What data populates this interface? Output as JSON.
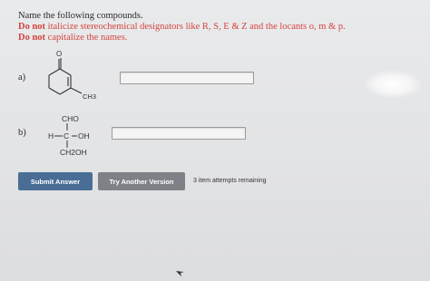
{
  "question": {
    "title": "Name the following compounds.",
    "instruction_1_bold": "Do not",
    "instruction_1_rest": " italicize stereochemical designators like R, S, E & Z and the locants o, m & p.",
    "instruction_2_bold": "Do not",
    "instruction_2_rest": " capitalize the names."
  },
  "parts": [
    {
      "label": "a)",
      "structure_labels": {
        "carbonyl_atom": "O",
        "substituent": "CH3"
      },
      "answer_value": ""
    },
    {
      "label": "b)",
      "structure_labels": {
        "top": "CHO",
        "left": "H",
        "center": "C",
        "right": "OH",
        "bottom": "CH2OH"
      },
      "answer_value": ""
    }
  ],
  "actions": {
    "submit_label": "Submit Answer",
    "try_another_label": "Try Another Version",
    "attempts_text": "3 item attempts remaining"
  },
  "colors": {
    "instruction_red": "#d4453f",
    "submit_blue": "#4a6d96",
    "try_gray": "#7e8286"
  }
}
